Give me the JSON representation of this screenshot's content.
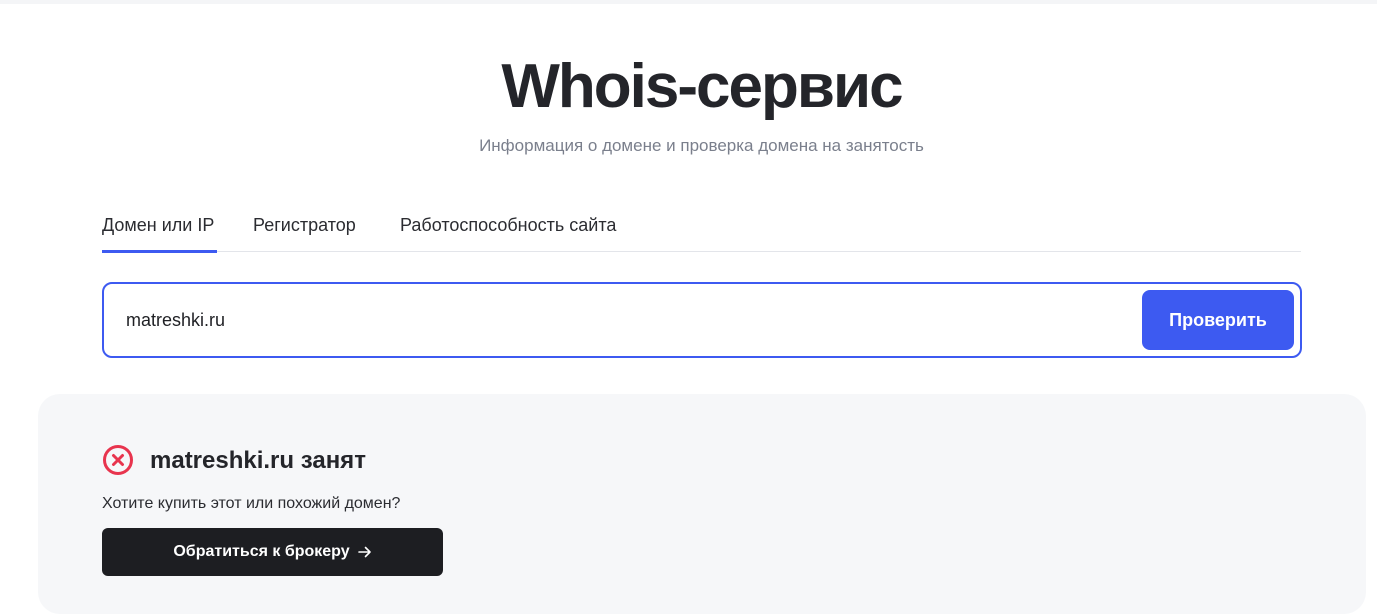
{
  "header": {
    "title": "Whois-сервис",
    "subtitle": "Информация о домене и проверка домена на занятость"
  },
  "tabs": [
    {
      "label": "Домен или IP",
      "active": true
    },
    {
      "label": "Регистратор",
      "active": false
    },
    {
      "label": "Работоспособность сайта",
      "active": false
    }
  ],
  "search": {
    "value": "matreshki.ru",
    "placeholder": "",
    "button_label": "Проверить"
  },
  "result": {
    "status_icon": "cross-circle-icon",
    "status_text": "matreshki.ru занят",
    "question": "Хотите купить этот или похожий домен?",
    "broker_button_label": "Обратиться к брокеру",
    "broker_button_icon": "arrow-right-icon"
  },
  "colors": {
    "accent": "#3d5af1",
    "status_busy": "#e8344e",
    "dark_button": "#1d1e22",
    "card_background": "#f6f7f9"
  }
}
